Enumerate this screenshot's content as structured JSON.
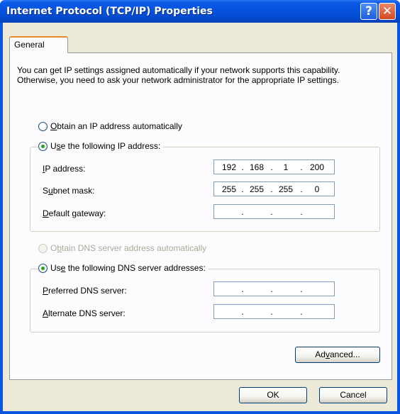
{
  "window": {
    "title": "Internet Protocol (TCP/IP) Properties",
    "help_glyph": "?",
    "close_glyph": "✕"
  },
  "tabs": [
    {
      "label": "General"
    }
  ],
  "description": "You can get IP settings assigned automatically if your network supports this capability. Otherwise, you need to ask your network administrator for the appropriate IP settings.",
  "ip": {
    "auto_option": {
      "pre": "",
      "key": "O",
      "post": "btain an IP address automatically",
      "selected": false
    },
    "manual_option": {
      "pre": "U",
      "key": "s",
      "post": "e the following IP address:",
      "selected": true
    },
    "fields": [
      {
        "pre": "",
        "key": "I",
        "post": "P address:",
        "octets": [
          "192",
          "168",
          "1",
          "200"
        ]
      },
      {
        "pre": "S",
        "key": "u",
        "post": "bnet mask:",
        "octets": [
          "255",
          "255",
          "255",
          "0"
        ]
      },
      {
        "pre": "",
        "key": "D",
        "post": "efault gateway:",
        "octets": [
          "",
          "",
          "",
          ""
        ]
      }
    ]
  },
  "dns": {
    "auto_option": {
      "pre": "O",
      "key": "b",
      "post": "tain DNS server address automatically",
      "selected": false,
      "disabled": true
    },
    "manual_option": {
      "pre": "Us",
      "key": "e",
      "post": " the following DNS server addresses:",
      "selected": true
    },
    "fields": [
      {
        "pre": "",
        "key": "P",
        "post": "referred DNS server:",
        "octets": [
          "",
          "",
          "",
          ""
        ]
      },
      {
        "pre": "",
        "key": "A",
        "post": "lternate DNS server:",
        "octets": [
          "",
          "",
          "",
          ""
        ]
      }
    ]
  },
  "buttons": {
    "advanced": {
      "pre": "Ad",
      "key": "v",
      "post": "anced..."
    },
    "ok": "OK",
    "cancel": "Cancel"
  },
  "colors": {
    "titlebar": "#0552dc",
    "dialog_face": "#ece9d8",
    "tab_accent": "#e68b2c",
    "radio_check": "#21a121"
  }
}
